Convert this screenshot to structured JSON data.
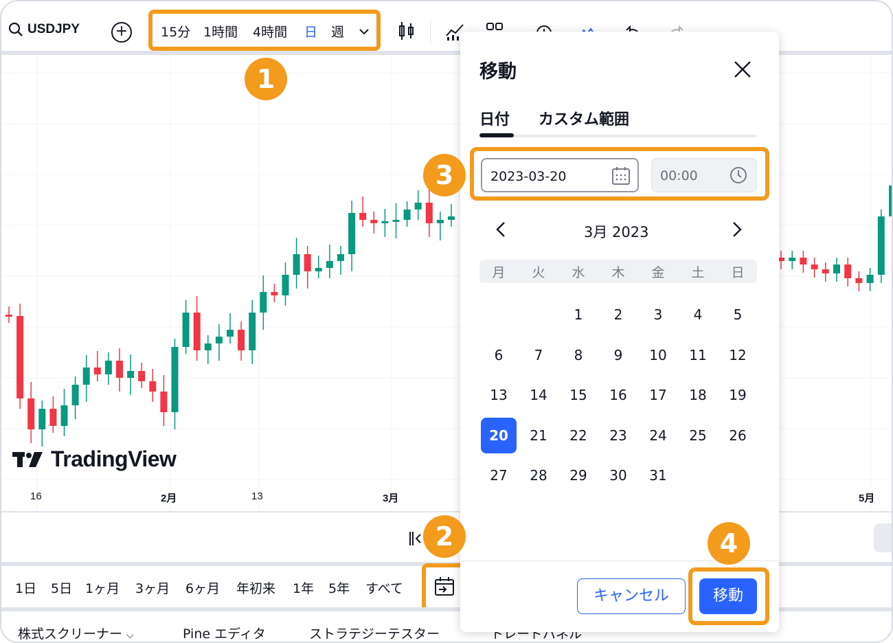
{
  "toolbar": {
    "symbol": "USDJPY",
    "intervals": [
      "15分",
      "1時間",
      "4時間",
      "日",
      "週"
    ],
    "active_interval": "日"
  },
  "chart": {
    "time_ticks": [
      "16",
      "2月",
      "13",
      "3月",
      "5月"
    ],
    "logo_text": "TradingView",
    "colors": {
      "up": "#089981",
      "down": "#f23645"
    }
  },
  "range_buttons": [
    "1日",
    "5日",
    "1ヶ月",
    "3ヶ月",
    "6ヶ月",
    "年初来",
    "1年",
    "5年",
    "すべて"
  ],
  "bottom_panels": [
    "株式スクリーナー",
    "Pine エディタ",
    "ストラテジーテスター",
    "トレードパネル"
  ],
  "dialog": {
    "title": "移動",
    "tabs": [
      "日付",
      "カスタム範囲"
    ],
    "date_value": "2023-03-20",
    "time_value": "00:00",
    "month_label": "3月 2023",
    "weekdays": [
      "月",
      "火",
      "水",
      "木",
      "金",
      "土",
      "日"
    ],
    "weeks": [
      [
        "",
        "",
        "1",
        "2",
        "3",
        "4",
        "5"
      ],
      [
        "6",
        "7",
        "8",
        "9",
        "10",
        "11",
        "12"
      ],
      [
        "13",
        "14",
        "15",
        "16",
        "17",
        "18",
        "19"
      ],
      [
        "20",
        "21",
        "22",
        "23",
        "24",
        "25",
        "26"
      ],
      [
        "27",
        "28",
        "29",
        "30",
        "31",
        "",
        ""
      ]
    ],
    "selected_day": "20",
    "cancel_label": "キャンセル",
    "go_label": "移動"
  },
  "badges": [
    "1",
    "2",
    "3",
    "4"
  ],
  "colors": {
    "accent": "#2962ff",
    "highlight": "#f29b1d"
  }
}
